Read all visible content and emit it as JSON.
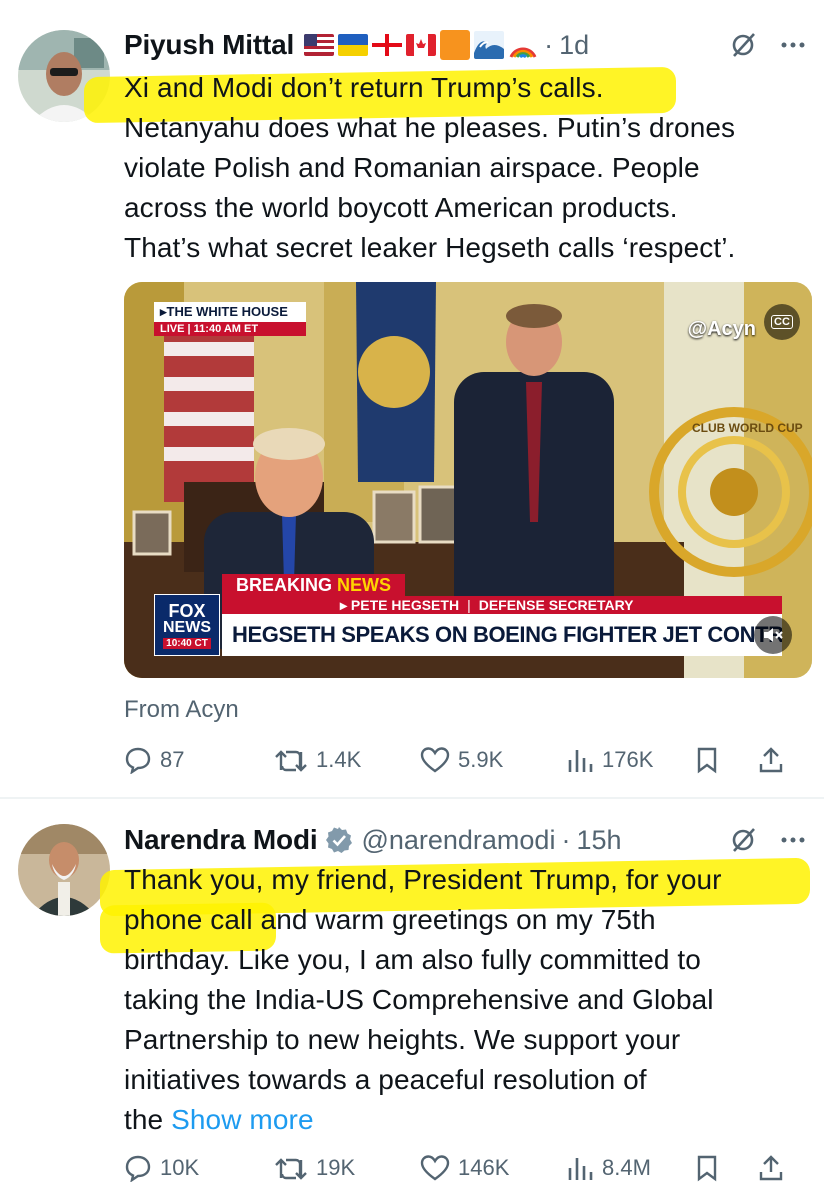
{
  "tweets": [
    {
      "author": "Piyush Mittal",
      "flags": [
        "🇺🇸",
        "🇺🇦",
        "🇬🇪",
        "🇨🇦",
        "🟧",
        "🌊",
        "🌈"
      ],
      "time": "1d",
      "text": "Xi and Modi don’t return Trump’s calls.\nNetanyahu does what he pleases. Putin’s drones\nviolate Polish and Romanian airspace. People\nacross the world boycott American products.\nThat’s what secret leaker Hegseth calls ‘respect’.",
      "media": {
        "network_badge": "THE WHITE HOUSE",
        "live_label": "LIVE",
        "live_time": "11:40 AM ET",
        "watermark": "@Acyn",
        "cc_label": "CC",
        "breaking_label": "BREAKING",
        "news_label": "NEWS",
        "lower_third_name": "▸ PETE HEGSETH",
        "lower_third_title": "DEFENSE SECRETARY",
        "headline": "HEGSETH SPEAKS ON BOEING FIGHTER JET CONTRACT",
        "channel_top": "FOX",
        "channel_bottom": "NEWS",
        "channel_time": "10:40 CT",
        "trophy_text": "CLUB WORLD CUP"
      },
      "source": "From Acyn",
      "stats": {
        "replies": "87",
        "reposts": "1.4K",
        "likes": "5.9K",
        "views": "176K"
      }
    },
    {
      "author": "Narendra Modi",
      "handle": "@narendramodi",
      "time": "15h",
      "text": "Thank you, my friend, President Trump, for your\nphone call and warm greetings on my 75th\nbirthday. Like you, I am also fully committed to\ntaking the India-US Comprehensive and Global\nPartnership to new heights. We support your\ninitiatives towards a peaceful resolution of\nthe ",
      "show_more": "Show more",
      "stats": {
        "replies": "10K",
        "reposts": "19K",
        "likes": "146K",
        "views": "8.4M"
      }
    }
  ],
  "colors": {
    "highlight": "#fff200",
    "link": "#1d9bf0",
    "muted": "#536471",
    "verified": "#829aab"
  }
}
